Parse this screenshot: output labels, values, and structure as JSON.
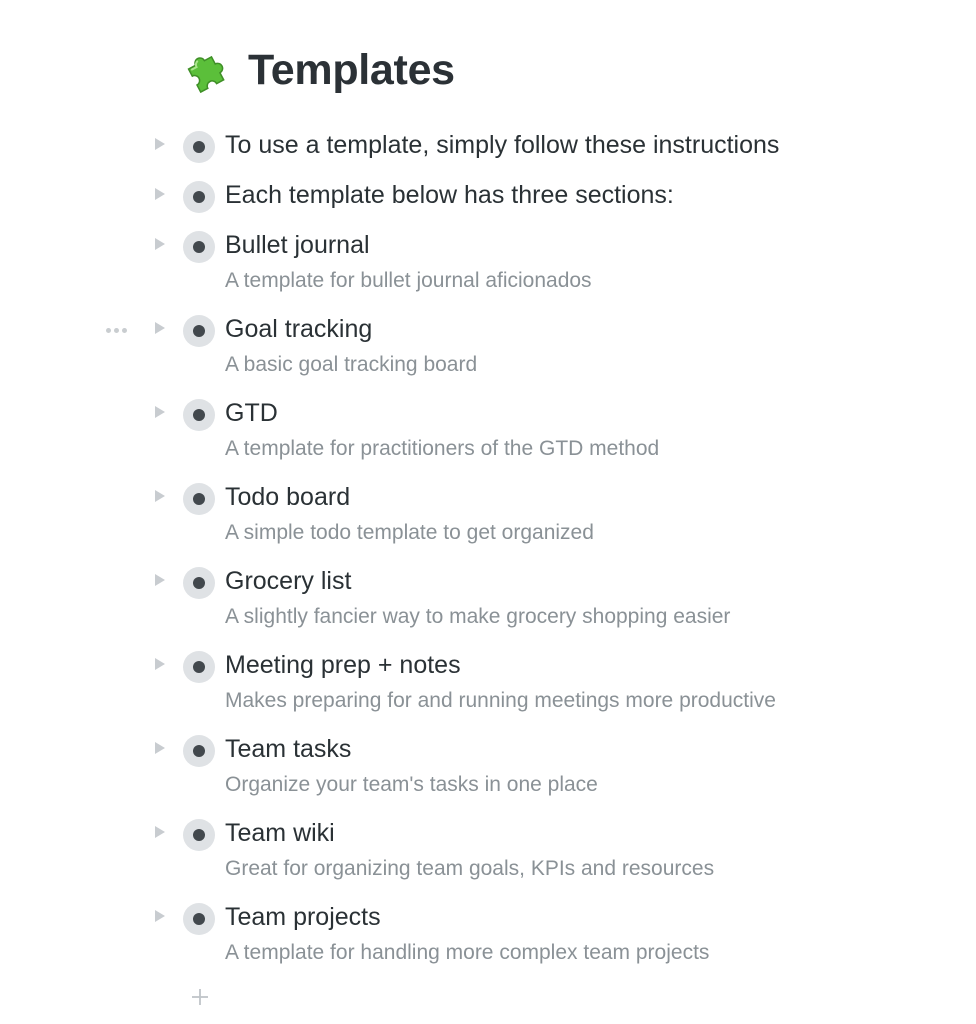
{
  "page": {
    "title": "Templates",
    "title_icon": "puzzle-piece-icon"
  },
  "items": [
    {
      "title": "To use a template, simply follow these instructions",
      "description": ""
    },
    {
      "title": "Each template below has three sections:",
      "description": ""
    },
    {
      "title": "Bullet journal",
      "description": "A template for bullet journal aficionados"
    },
    {
      "title": "Goal tracking",
      "description": "A basic goal tracking board"
    },
    {
      "title": "GTD",
      "description": "A template for practitioners of the GTD method"
    },
    {
      "title": "Todo board",
      "description": "A simple todo template to get organized"
    },
    {
      "title": "Grocery list",
      "description": "A slightly fancier way to make grocery shopping easier"
    },
    {
      "title": "Meeting prep + notes",
      "description": "Makes preparing for and running meetings more productive"
    },
    {
      "title": "Team tasks",
      "description": "Organize your team's tasks in one place"
    },
    {
      "title": "Team wiki",
      "description": "Great for organizing team goals, KPIs and resources"
    },
    {
      "title": "Team projects",
      "description": "A template for handling more complex team projects"
    }
  ],
  "icons": {
    "expand": "triangle-right-icon",
    "bullet": "bullet-icon",
    "more": "more-dots-icon",
    "add": "plus-icon"
  },
  "colors": {
    "text": "#2a3135",
    "muted": "#8a9196",
    "bullet_ring": "#dfe2e5",
    "bullet_dot": "#42484d",
    "arrow": "#c8ccd0",
    "puzzle_green": "#5bbf3a"
  }
}
